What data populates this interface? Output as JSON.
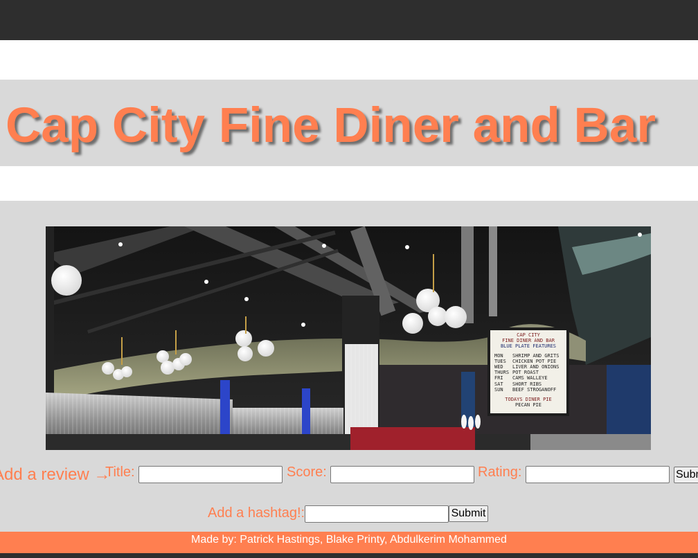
{
  "header": {
    "title": "Cap City Fine Diner and Bar"
  },
  "photo": {
    "menu_board": {
      "line1": "CAP CITY",
      "line2": "FINE DINER AND BAR",
      "line3": "BLUE PLATE FEATURES",
      "rows": [
        {
          "day": "MON",
          "dish": "SHRIMP AND GRITS"
        },
        {
          "day": "TUES",
          "dish": "CHICKEN POT PIE"
        },
        {
          "day": "WED",
          "dish": "LIVER AND ONIONS"
        },
        {
          "day": "THURS",
          "dish": "POT ROAST"
        },
        {
          "day": "FRI",
          "dish": "CAMS WALLEYE"
        },
        {
          "day": "SAT",
          "dish": "SHORT RIBS"
        },
        {
          "day": "SUN",
          "dish": "BEEF STROGANOFF"
        }
      ],
      "pie_heading": "TODAYS DINER PIE",
      "pie": "PECAN PIE"
    }
  },
  "review_form": {
    "lead": "Add a review →",
    "title_label": "Title:",
    "title_value": "",
    "score_label": "Score:",
    "score_value": "",
    "rating_label": "Rating:",
    "rating_value": "",
    "submit_label": "Submit"
  },
  "hashtag_form": {
    "label": "Add a hashtag!:",
    "value": "",
    "submit_label": "Submit"
  },
  "footer": {
    "credits": "Made by: Patrick Hastings, Blake Printy, Abdulkerim Mohammed"
  },
  "colors": {
    "accent": "#ff7f50",
    "band": "#d9d9d9",
    "topbar": "#2e2e2e"
  }
}
